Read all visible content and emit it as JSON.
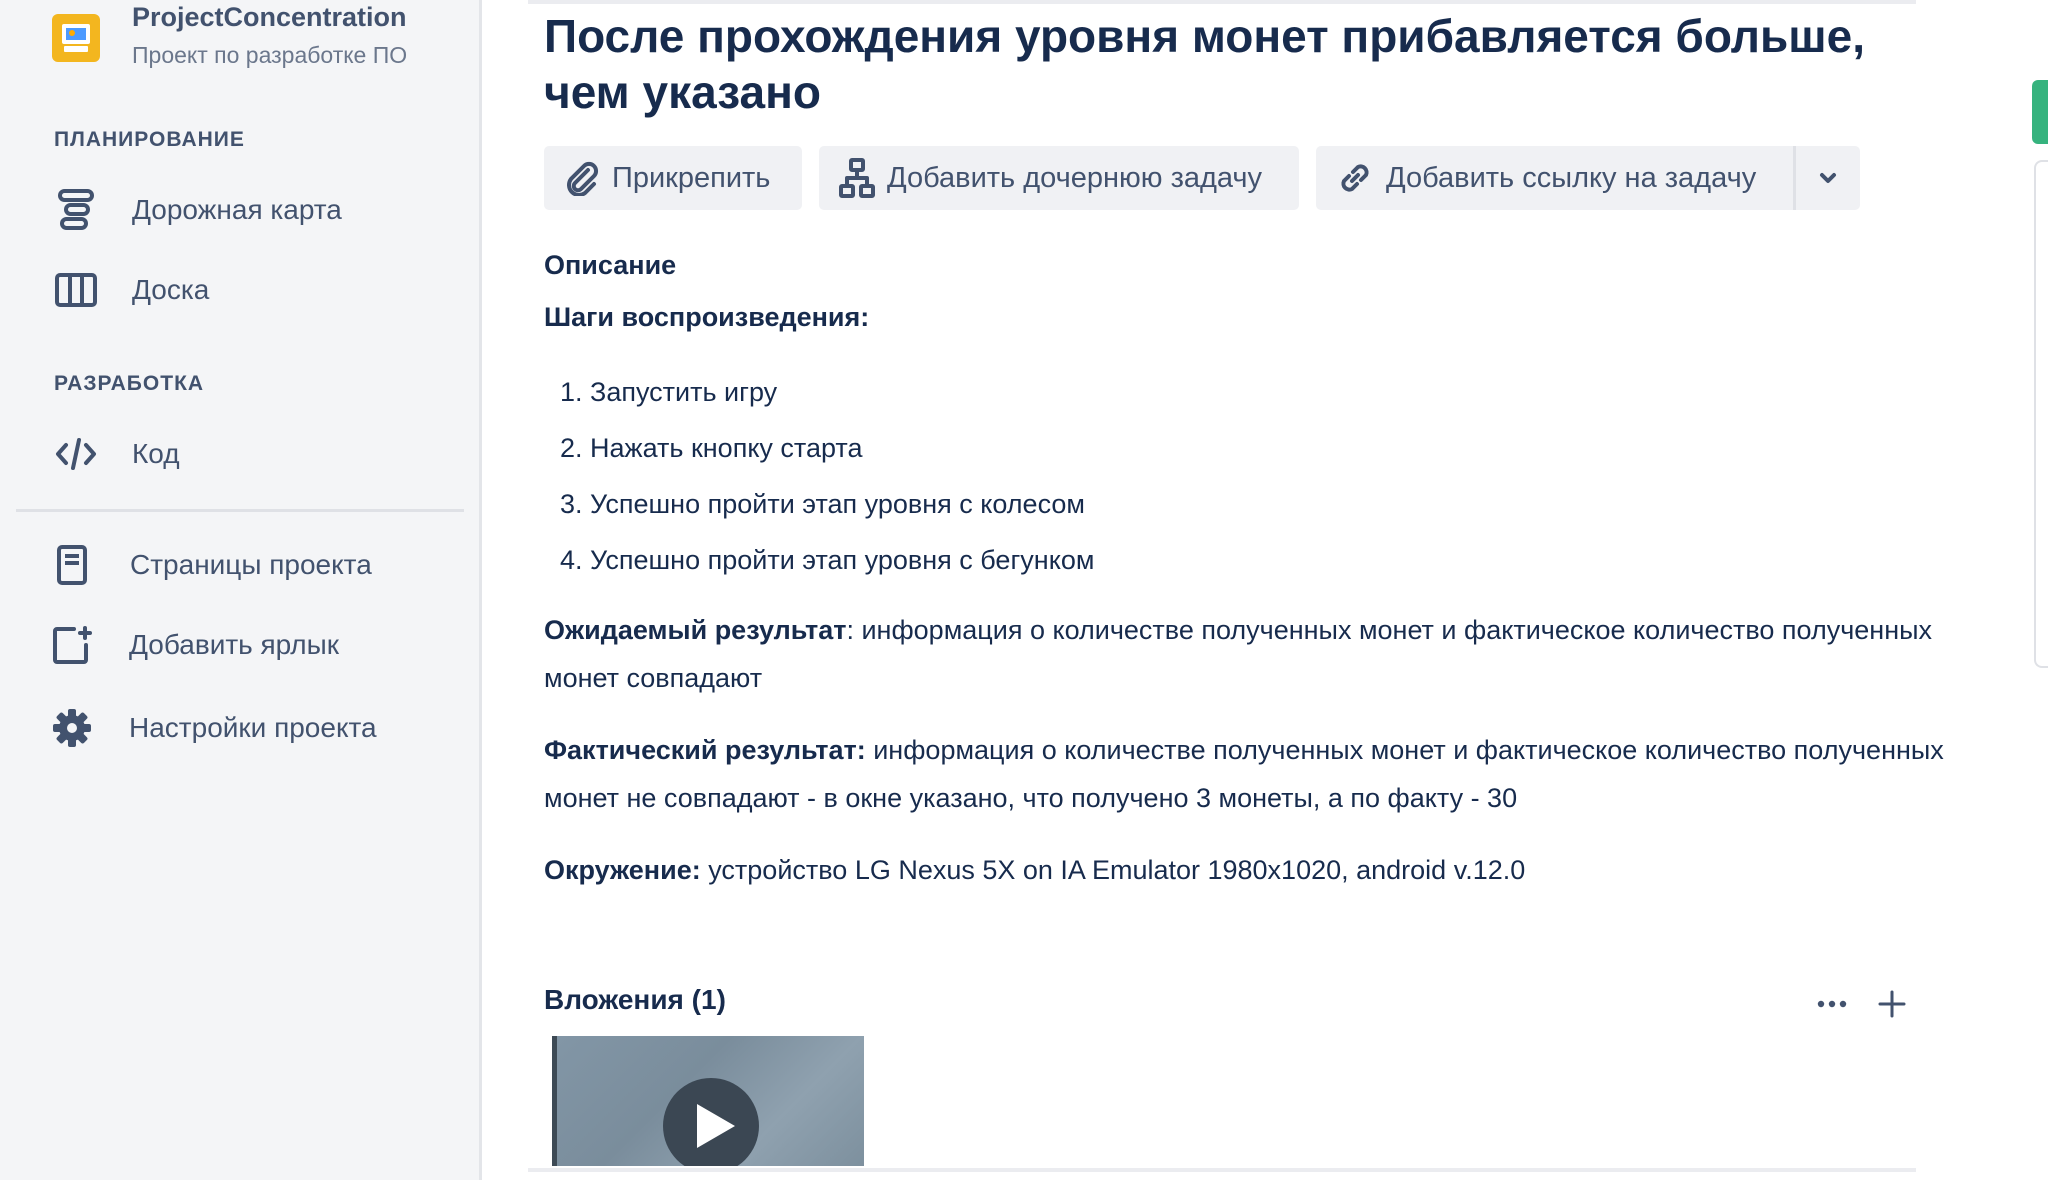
{
  "sidebar": {
    "project_name": "ProjectConcentration",
    "project_subtitle": "Проект по разработке ПО",
    "planning_title": "ПЛАНИРОВАНИЕ",
    "planning_items": [
      {
        "label": "Дорожная карта",
        "icon": "roadmap-icon"
      },
      {
        "label": "Доска",
        "icon": "board-icon"
      }
    ],
    "development_title": "РАЗРАБОТКА",
    "development_items": [
      {
        "label": "Код",
        "icon": "code-icon"
      }
    ],
    "bottom_items": [
      {
        "label": "Страницы проекта",
        "icon": "page-icon"
      },
      {
        "label": "Добавить ярлык",
        "icon": "add-shortcut-icon"
      },
      {
        "label": "Настройки проекта",
        "icon": "gear-icon"
      }
    ]
  },
  "issue": {
    "title": "После прохождения уровня монет прибавляется больше, чем указано",
    "toolbar": {
      "attach_label": "Прикрепить",
      "add_child_label": "Добавить дочернюю задачу",
      "add_link_label": "Добавить ссылку на задачу"
    },
    "description_heading": "Описание",
    "steps_heading": "Шаги воспроизведения:",
    "steps": [
      "1. Запустить игру",
      "2. Нажать кнопку старта",
      "3. Успешно пройти этап уровня с колесом",
      "4. Успешно пройти этап уровня с бегунком"
    ],
    "expected_label": "Ожидаемый результат",
    "expected_text": ": информация о количестве полученных монет и фактическое количество полученных монет совпадают",
    "actual_label": "Фактический результат:",
    "actual_text": " информация о количестве полученных монет и фактическое количество полученных монет не совпадают - в окне указано, что получено 3 монеты, а по факту - 30",
    "environment_label": "Окружение:",
    "environment_text": " устройство LG Nexus 5X on IA Emulator 1980x1020, android v.12.0",
    "attachments_heading": "Вложения (1)"
  },
  "colors": {
    "sidebar_bg": "#f4f5f7",
    "text_primary": "#172b4d",
    "text_secondary": "#42526e",
    "button_bg": "#f0f1f4",
    "project_avatar": "#f3b61f",
    "status_green": "#36b37e"
  }
}
